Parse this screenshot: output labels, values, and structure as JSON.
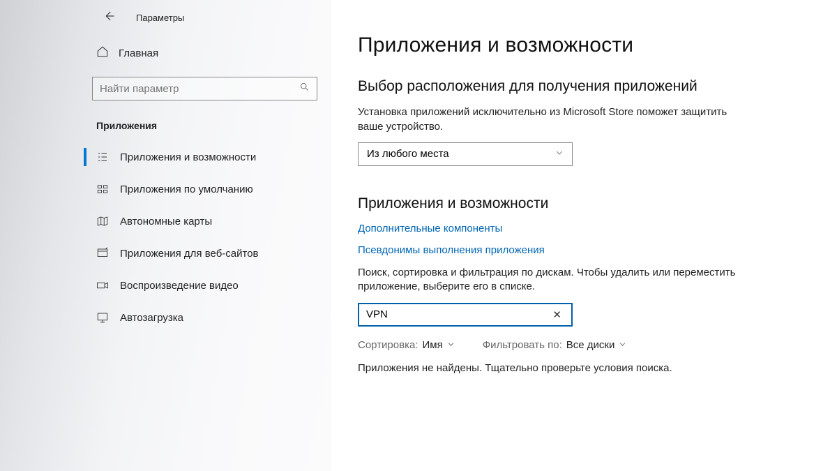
{
  "window_title": "Параметры",
  "sidebar": {
    "home_label": "Главная",
    "search_placeholder": "Найти параметр",
    "section_title": "Приложения",
    "items": [
      {
        "label": "Приложения и возможности",
        "icon": "apps-list-icon"
      },
      {
        "label": "Приложения по умолчанию",
        "icon": "defaults-icon"
      },
      {
        "label": "Автономные карты",
        "icon": "maps-icon"
      },
      {
        "label": "Приложения для веб-сайтов",
        "icon": "web-apps-icon"
      },
      {
        "label": "Воспроизведение видео",
        "icon": "video-icon"
      },
      {
        "label": "Автозагрузка",
        "icon": "startup-icon"
      }
    ]
  },
  "main": {
    "title": "Приложения и возможности",
    "section1": {
      "heading": "Выбор расположения для получения приложений",
      "description": "Установка приложений исключительно из Microsoft Store поможет защитить ваше устройство.",
      "dropdown_value": "Из любого места"
    },
    "section2": {
      "heading": "Приложения и возможности",
      "link_optional": "Дополнительные компоненты",
      "link_aliases": "Псевдонимы выполнения приложения",
      "hint": "Поиск, сортировка и фильтрация по дискам. Чтобы удалить или переместить приложение, выберите его в списке.",
      "search_value": "VPN",
      "sort_label": "Сортировка:",
      "sort_value": "Имя",
      "filter_label": "Фильтровать по:",
      "filter_value": "Все диски",
      "no_results": "Приложения не найдены. Тщательно проверьте условия поиска."
    }
  }
}
